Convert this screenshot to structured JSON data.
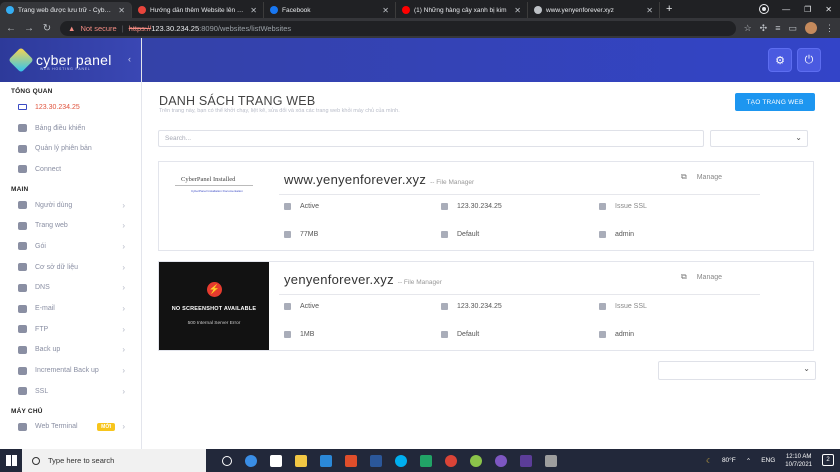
{
  "browser": {
    "tabs": [
      {
        "title": "Trang web được lưu trữ - CyberP",
        "active": true,
        "favicon_color": "#35aef3"
      },
      {
        "title": "Hướng dẫn thêm Website lên Cyb",
        "active": false,
        "favicon_color": "#e8453c"
      },
      {
        "title": "Facebook",
        "active": false,
        "favicon_color": "#1877f2"
      },
      {
        "title": "(1) Những hàng cây xanh bị kim",
        "active": false,
        "favicon_color": "#ff0000"
      },
      {
        "title": "www.yenyenforever.xyz",
        "active": false,
        "favicon_color": "#bdc1c6"
      }
    ],
    "security_label": "Not secure",
    "url_scheme": "https://",
    "url_host": "123.30.234.25",
    "url_path": ":8090/websites/listWebsites"
  },
  "sidebar": {
    "brand_name": "cyber panel",
    "brand_tagline": "WEB HOSTING PANEL",
    "sections": [
      {
        "title": "TỔNG QUAN",
        "items": [
          {
            "label": "123.30.234.25",
            "icon": "monitor-icon",
            "chevron": false,
            "ip": true
          },
          {
            "label": "Bảng điều khiển",
            "icon": "dashboard-icon",
            "chevron": false
          },
          {
            "label": "Quản lý phiên bản",
            "icon": "info-icon",
            "chevron": false
          },
          {
            "label": "Connect",
            "icon": "link-icon",
            "chevron": false
          }
        ]
      },
      {
        "title": "MAIN",
        "items": [
          {
            "label": "Người dùng",
            "icon": "users-icon",
            "chevron": true
          },
          {
            "label": "Trang web",
            "icon": "globe-icon",
            "chevron": true
          },
          {
            "label": "Gói",
            "icon": "cube-icon",
            "chevron": true
          },
          {
            "label": "Cơ sở dữ liệu",
            "icon": "database-icon",
            "chevron": true
          },
          {
            "label": "DNS",
            "icon": "sitemap-icon",
            "chevron": true
          },
          {
            "label": "E-mail",
            "icon": "paper-plane-icon",
            "chevron": true
          },
          {
            "label": "FTP",
            "icon": "cloud-upload-icon",
            "chevron": true
          },
          {
            "label": "Back up",
            "icon": "copy-icon",
            "chevron": true
          },
          {
            "label": "Incremental Back up",
            "icon": "save-icon",
            "chevron": true
          },
          {
            "label": "SSL",
            "icon": "lock-icon",
            "chevron": true
          }
        ]
      },
      {
        "title": "MÁY CHỦ",
        "items": [
          {
            "label": "Web Terminal",
            "icon": "terminal-icon",
            "chevron": true,
            "badge": "MỚI"
          }
        ]
      }
    ]
  },
  "page": {
    "title": "DANH SÁCH TRANG WEB",
    "subtitle": "Trên trang này, bạn có thể khởi chạy, liệt kê, sửa đổi và xóa các trang web khỏi máy chủ của mình.",
    "create_button": "TẠO TRANG WEB",
    "search_placeholder": "Search..."
  },
  "websites": [
    {
      "domain": "www.yenyenforever.xyz",
      "file_manager": "-- File Manager",
      "manage": "Manage",
      "state": "Active",
      "ip": "123.30.234.25",
      "ssl": "Issue SSL",
      "disk": "77MB",
      "package": "Default",
      "owner": "admin",
      "screenshot": {
        "type": "light",
        "title": "CyberPanel Installed",
        "caption": "CyberPanel Installation Documentation"
      }
    },
    {
      "domain": "yenyenforever.xyz",
      "file_manager": "-- File Manager",
      "manage": "Manage",
      "state": "Active",
      "ip": "123.30.234.25",
      "ssl": "Issue SSL",
      "disk": "1MB",
      "package": "Default",
      "owner": "admin",
      "screenshot": {
        "type": "dark",
        "title": "NO SCREENSHOT AVAILABLE",
        "caption": "500 Internal Server Error"
      }
    }
  ],
  "taskbar": {
    "search_placeholder": "Type here to search",
    "temperature": "80°F",
    "language": "ENG",
    "time": "12:10 AM",
    "date": "10/7/2021",
    "notification_count": "2"
  }
}
